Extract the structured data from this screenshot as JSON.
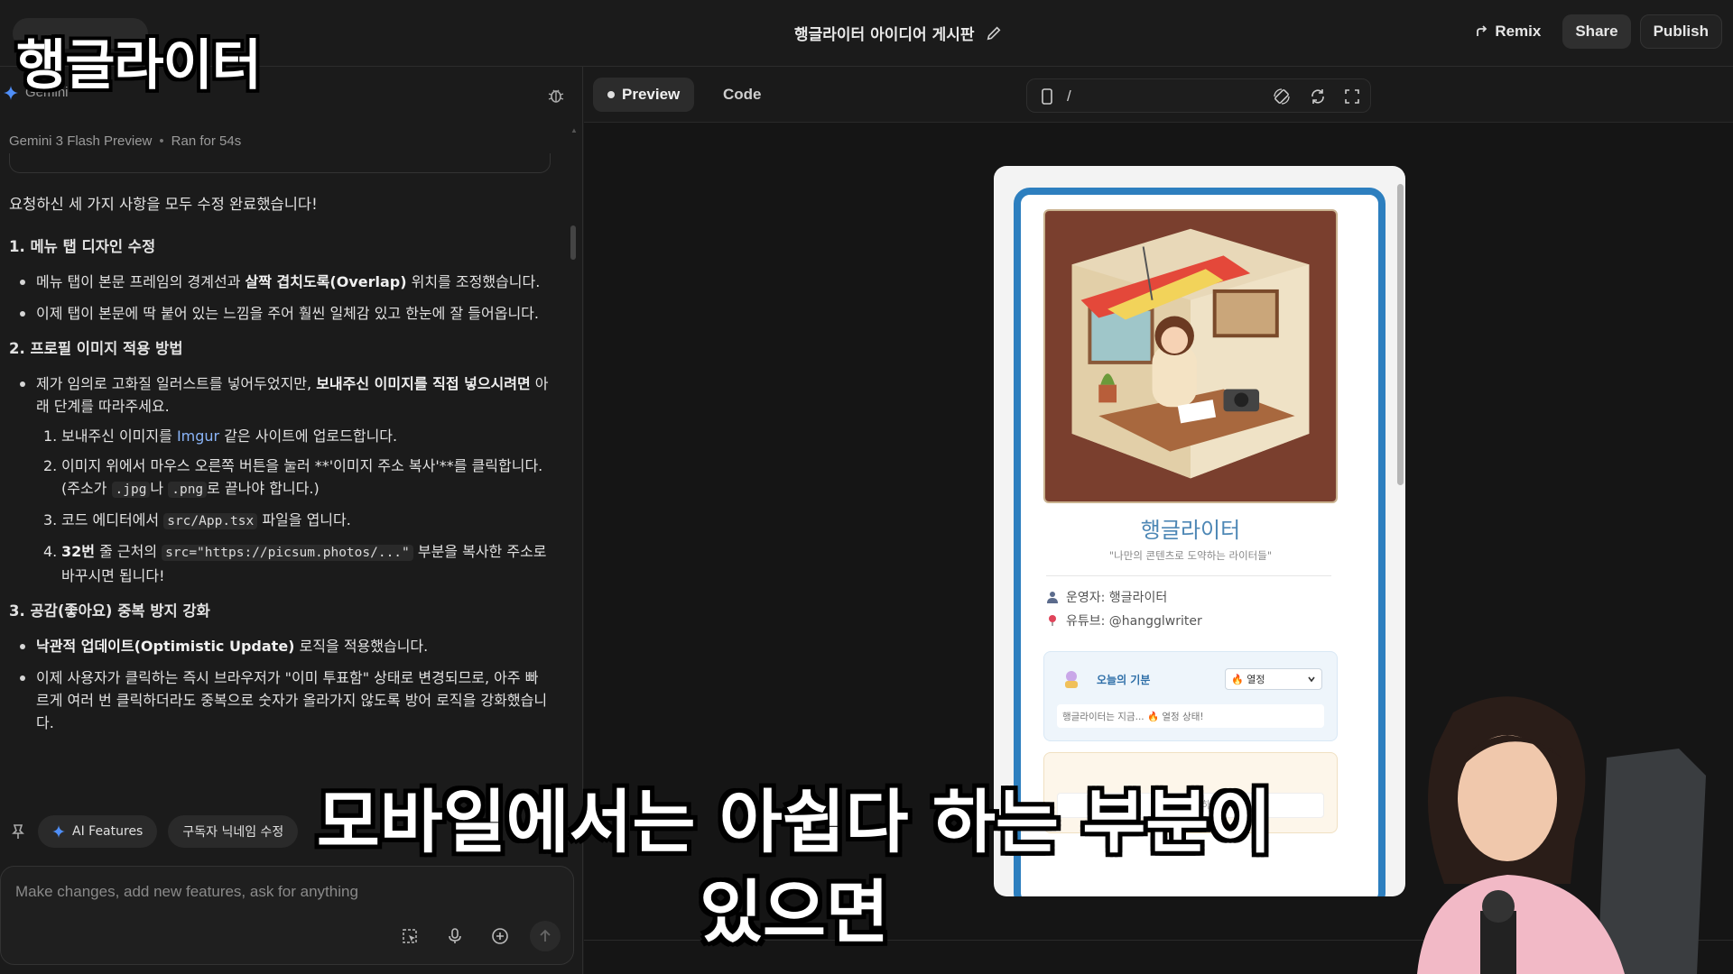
{
  "overlay": {
    "title": "행글라이터",
    "subtitle_line1": "모바일에서는 아쉽다 하는 부분이",
    "subtitle_line2": "있으면"
  },
  "topbar": {
    "title": "행글라이터 아이디어 게시판",
    "remix": "Remix",
    "share": "Share",
    "publish": "Publish"
  },
  "left": {
    "assistant": "Gemini",
    "model": "Gemini 3 Flash Preview",
    "ran": "Ran for 54s",
    "intro": "요청하신 세 가지 사항을 모두 수정 완료했습니다!",
    "s1": {
      "heading": "1. 메뉴 탭 디자인 수정",
      "b1_pre": "메뉴 탭이 본문 프레임의 경계선과 ",
      "b1_bold": "살짝 겹치도록(Overlap)",
      "b1_post": " 위치를 조정했습니다.",
      "b2": "이제 탭이 본문에 딱 붙어 있는 느낌을 주어 훨씬 일체감 있고 한눈에 잘 들어옵니다."
    },
    "s2": {
      "heading": "2. 프로필 이미지 적용 방법",
      "b1_pre": "제가 임의로 고화질 일러스트를 넣어두었지만, ",
      "b1_bold": "보내주신 이미지를 직접 넣으시려면",
      "b1_post": " 아래 단계를 따라주세요.",
      "step1_num": "1.",
      "step1_pre": "보내주신 이미지를 ",
      "step1_link": "Imgur",
      "step1_post": " 같은 사이트에 업로드합니다.",
      "step2_num": "2.",
      "step2_a": "이미지 위에서 마우스 오른쪽 버튼을 눌러 **'이미지 주소 복사'**를 클릭합니다. (주소가 ",
      "step2_code1": ".jpg",
      "step2_b": "나 ",
      "step2_code2": ".png",
      "step2_c": "로 끝나야 합니다.)",
      "step3_num": "3.",
      "step3_pre": "코드 에디터에서 ",
      "step3_code": "src/App.tsx",
      "step3_post": " 파일을 엽니다.",
      "step4_num": "4.",
      "step4_bold": "32번",
      "step4_a": " 줄 근처의 ",
      "step4_code": "src=\"https://picsum.photos/...\"",
      "step4_b": " 부분을 복사한 주소로 바꾸시면 됩니다!"
    },
    "s3": {
      "heading": "3. 공감(좋아요) 중복 방지 강화",
      "b1_bold": "낙관적 업데이트(Optimistic Update)",
      "b1_post": " 로직을 적용했습니다.",
      "b2": "이제 사용자가 클릭하는 즉시 브라우저가 \"이미 투표함\" 상태로 변경되므로, 아주 빠르게 여러 번 클릭하더라도 중복으로 숫자가 올라가지 않도록 방어 로직을 강화했습니다."
    },
    "chips": [
      "AI Features",
      "구독자 닉네임 수정"
    ],
    "input_placeholder": "Make changes, add new features, ask for anything"
  },
  "right": {
    "tab_preview": "Preview",
    "tab_code": "Code",
    "url": "/",
    "app": {
      "title": "행글라이터",
      "subtitle": "\"나만의 콘텐츠로 도약하는 라이터들\"",
      "operator": "운영자: 행글라이터",
      "youtube": "유튜브: @hangglwriter",
      "mood_label": "오늘의 기분",
      "mood_value": "🔥 열정",
      "mood_status": "행글라이터는 지금... 🔥 열정 상태!",
      "msg_placeholder": "메시지를 ...하세요"
    }
  },
  "colors": {
    "accent_blue": "#2d7fbf",
    "title_blue": "#4d87b5",
    "link": "#8ab4f8"
  }
}
